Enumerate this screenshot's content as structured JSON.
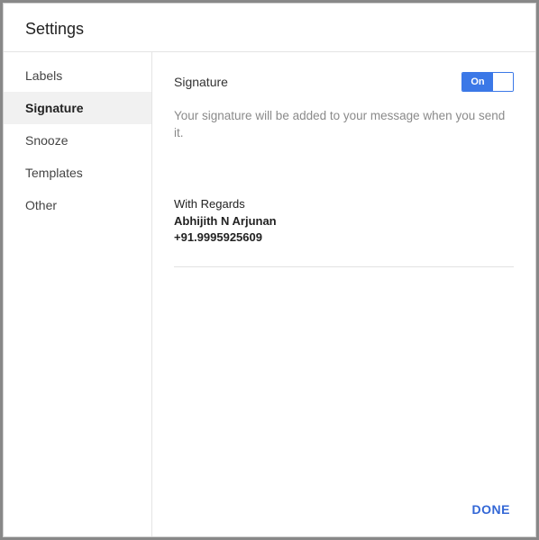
{
  "header": {
    "title": "Settings"
  },
  "sidebar": {
    "items": [
      {
        "label": "Labels"
      },
      {
        "label": "Signature"
      },
      {
        "label": "Snooze"
      },
      {
        "label": "Templates"
      },
      {
        "label": "Other"
      }
    ],
    "active_index": 1
  },
  "content": {
    "section_title": "Signature",
    "toggle": {
      "state": "on",
      "on_label": "On"
    },
    "description": "Your signature will be added to your message when you send it.",
    "signature": {
      "greeting": "With Regards",
      "name": "Abhijith N Arjunan",
      "phone": "+91.9995925609"
    }
  },
  "footer": {
    "done_label": "DONE"
  }
}
